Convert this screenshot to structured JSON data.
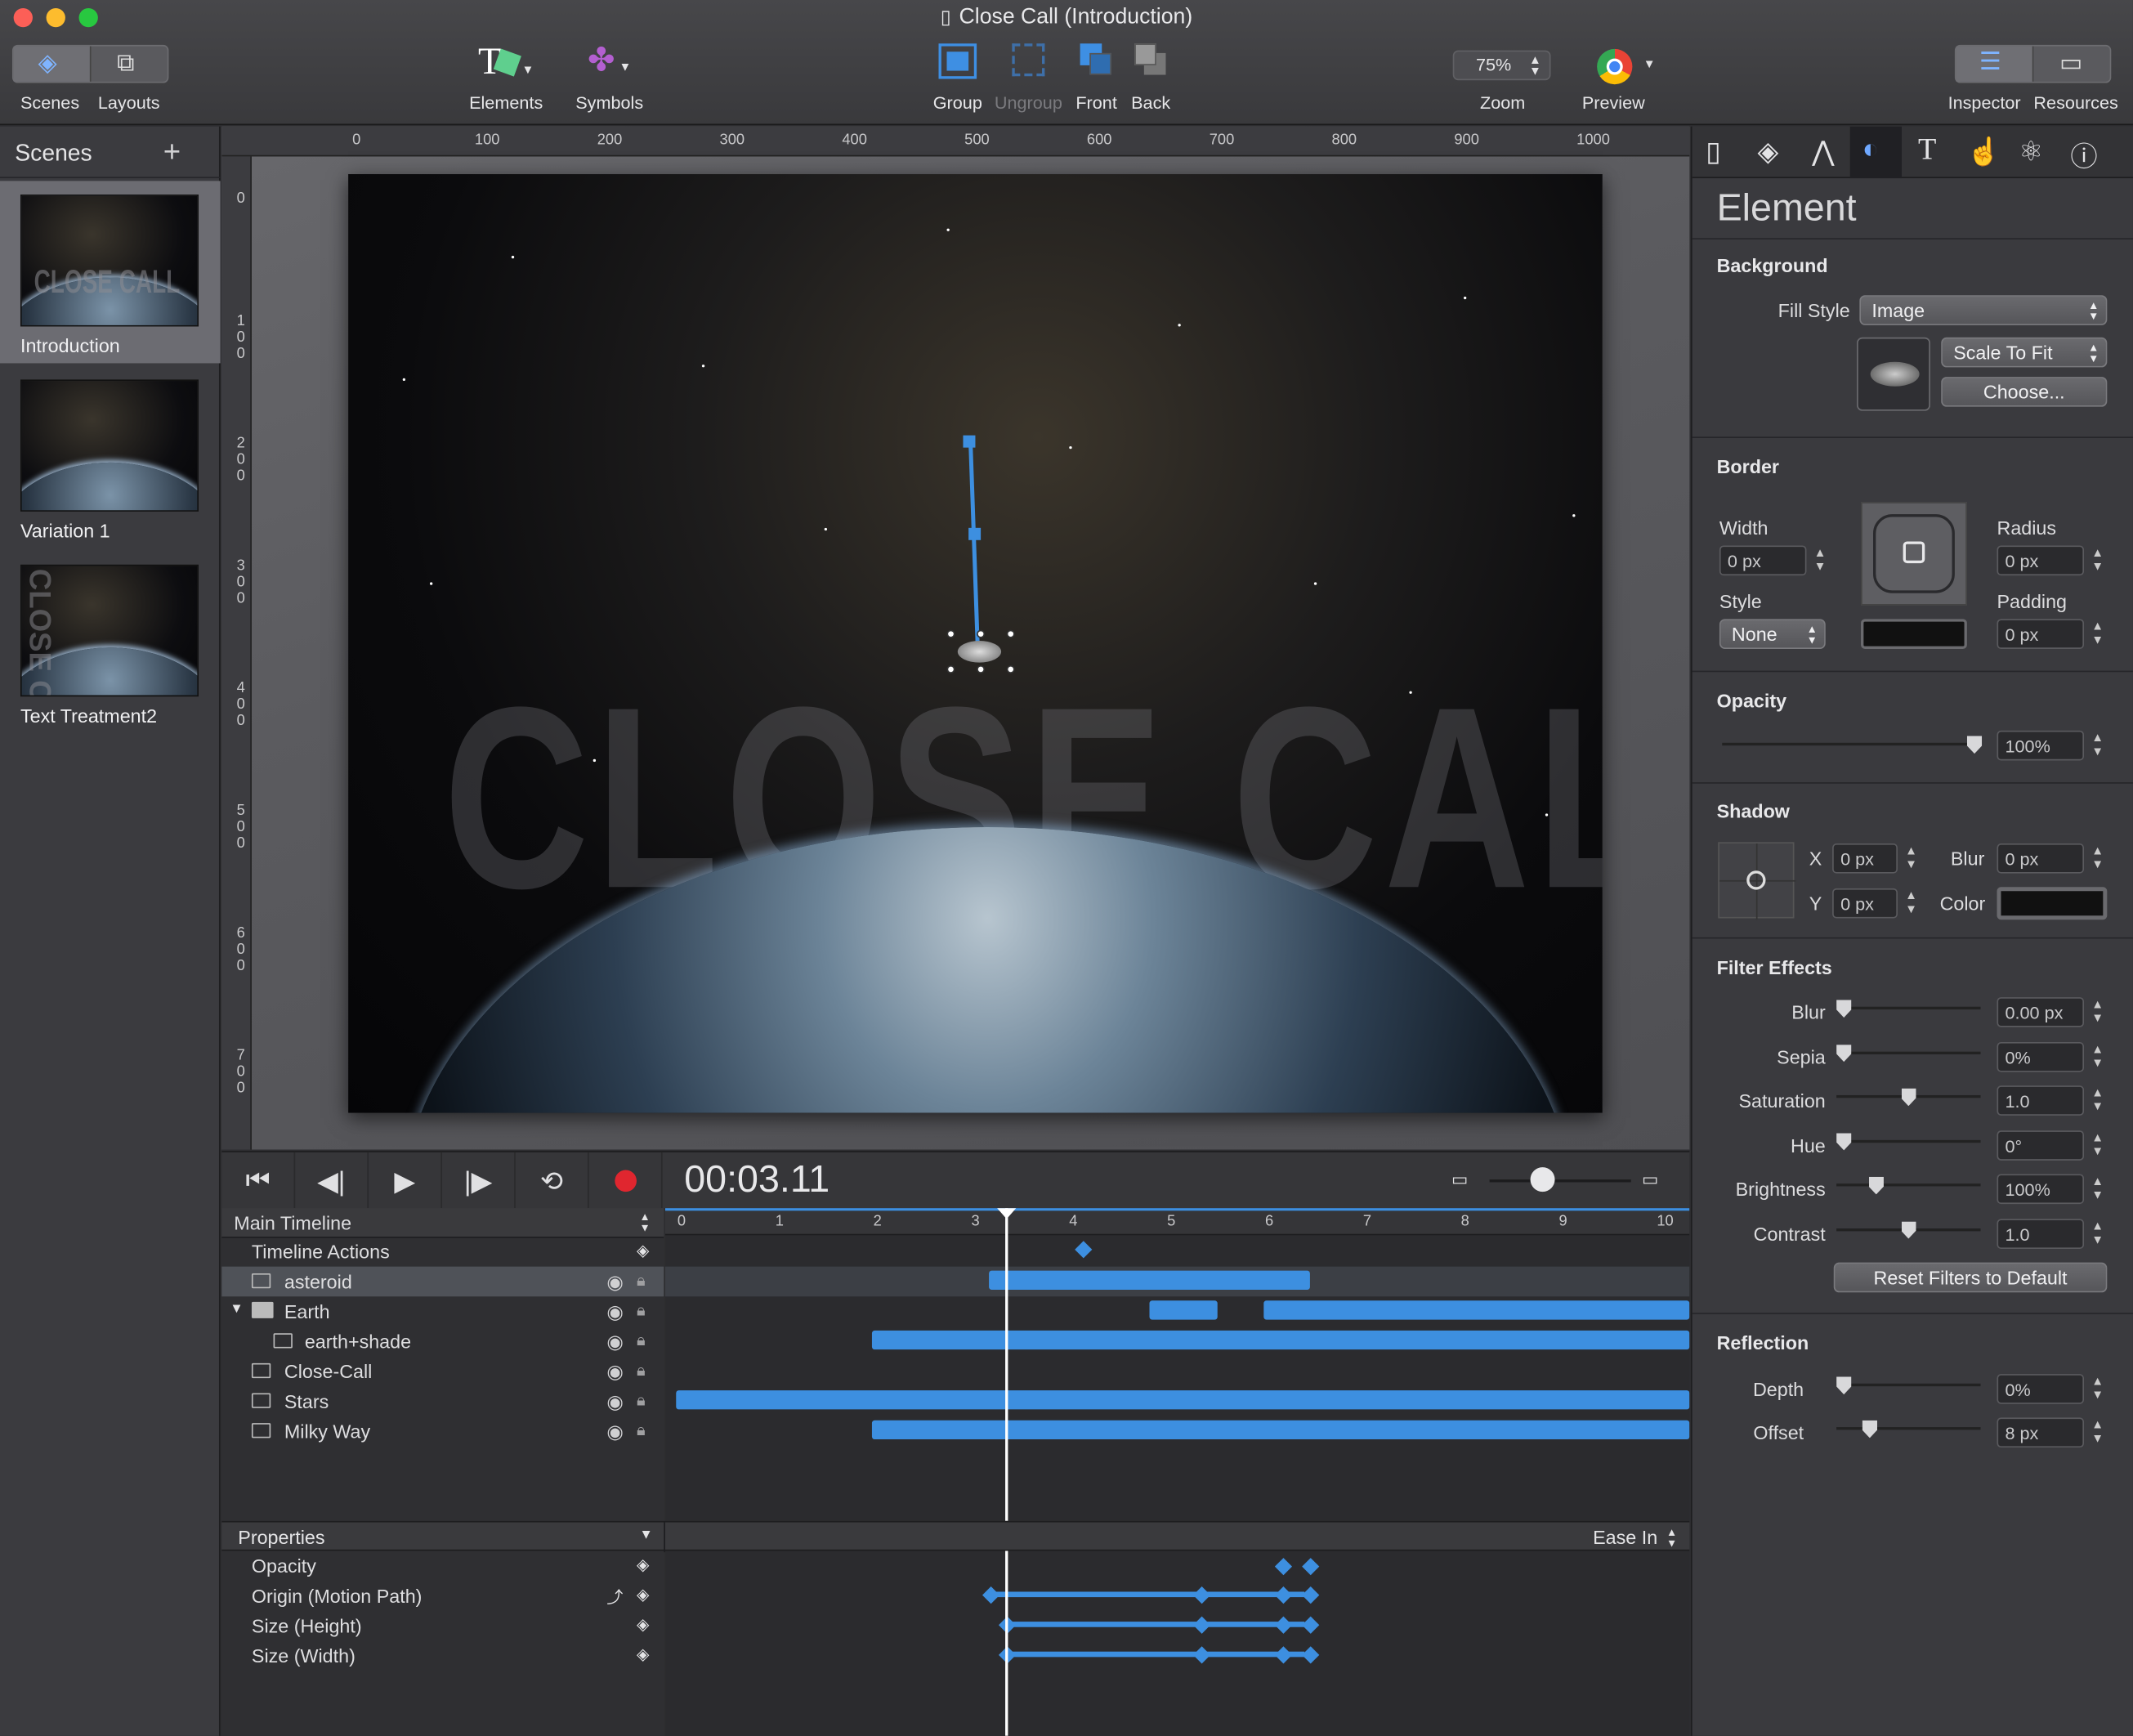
{
  "window": {
    "title": "Close Call (Introduction)"
  },
  "toolbar": {
    "scenes": "Scenes",
    "layouts": "Layouts",
    "elements": "Elements",
    "symbols": "Symbols",
    "group": "Group",
    "ungroup": "Ungroup",
    "front": "Front",
    "back": "Back",
    "zoom_value": "75%",
    "zoom": "Zoom",
    "preview": "Preview",
    "inspector": "Inspector",
    "resources": "Resources"
  },
  "scenes_panel": {
    "title": "Scenes",
    "add": "+",
    "items": [
      {
        "name": "Introduction"
      },
      {
        "name": "Variation 1"
      },
      {
        "name": "Text Treatment2"
      }
    ]
  },
  "canvas": {
    "ruler_h": [
      "0",
      "100",
      "200",
      "300",
      "400",
      "500",
      "600",
      "700",
      "800",
      "900",
      "1000"
    ],
    "ruler_v": [
      "0",
      "1\n0\n0",
      "2\n0\n0",
      "3\n0\n0",
      "4\n0\n0",
      "5\n0\n0",
      "6\n0\n0",
      "7\n0\n0"
    ],
    "title_text": "CLOSE CALL",
    "thumb_text": "CLOSE CALL"
  },
  "timeline": {
    "timecode": "00:03.11",
    "main": "Main Timeline",
    "ticks": [
      "0",
      "1",
      "2",
      "3",
      "4",
      "5",
      "6",
      "7",
      "8",
      "9",
      "10"
    ],
    "rows": [
      {
        "label": "Timeline Actions"
      },
      {
        "label": "asteroid"
      },
      {
        "label": "Earth"
      },
      {
        "label": "earth+shade"
      },
      {
        "label": "Close-Call"
      },
      {
        "label": "Stars"
      },
      {
        "label": "Milky Way"
      }
    ],
    "properties": "Properties",
    "easing": "Ease In",
    "props": [
      {
        "label": "Opacity"
      },
      {
        "label": "Origin (Motion Path)"
      },
      {
        "label": "Size (Height)"
      },
      {
        "label": "Size (Width)"
      }
    ]
  },
  "inspector": {
    "title": "Element",
    "background": {
      "label": "Background",
      "fill_style_label": "Fill Style",
      "fill_style": "Image",
      "scale": "Scale To Fit",
      "choose": "Choose..."
    },
    "border": {
      "label": "Border",
      "width_label": "Width",
      "width": "0 px",
      "style_label": "Style",
      "style": "None",
      "radius_label": "Radius",
      "radius": "0 px",
      "padding_label": "Padding",
      "padding": "0 px",
      "color": "#000000"
    },
    "opacity": {
      "label": "Opacity",
      "value": "100%",
      "level": 1.0
    },
    "shadow": {
      "label": "Shadow",
      "x_label": "X",
      "x": "0 px",
      "y_label": "Y",
      "y": "0 px",
      "blur_label": "Blur",
      "blur": "0 px",
      "color_label": "Color",
      "color": "#000000"
    },
    "filters": {
      "label": "Filter Effects",
      "items": [
        {
          "label": "Blur",
          "value": "0.00 px",
          "level": 0.0
        },
        {
          "label": "Sepia",
          "value": "0%",
          "level": 0.0
        },
        {
          "label": "Saturation",
          "value": "1.0",
          "level": 0.5
        },
        {
          "label": "Hue",
          "value": "0°",
          "level": 0.0
        },
        {
          "label": "Brightness",
          "value": "100%",
          "level": 0.25
        },
        {
          "label": "Contrast",
          "value": "1.0",
          "level": 0.5
        }
      ],
      "reset": "Reset Filters to Default"
    },
    "reflection": {
      "label": "Reflection",
      "depth_label": "Depth",
      "depth": "0%",
      "depth_level": 0.0,
      "offset_label": "Offset",
      "offset": "8 px",
      "offset_level": 0.2
    }
  },
  "colors": {
    "accent": "#3d8fe0",
    "record": "#e0262f"
  }
}
